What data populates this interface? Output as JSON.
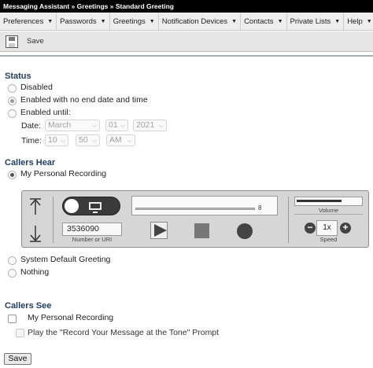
{
  "title_bar": "Messaging Assistant » Greetings » Standard Greeting",
  "menu": [
    {
      "label": "Preferences"
    },
    {
      "label": "Passwords"
    },
    {
      "label": "Greetings"
    },
    {
      "label": "Notification Devices"
    },
    {
      "label": "Contacts"
    },
    {
      "label": "Private Lists"
    },
    {
      "label": "Help"
    }
  ],
  "toolbar": {
    "save_label": "Save",
    "save_icon": "save-icon"
  },
  "status": {
    "heading": "Status",
    "options": [
      {
        "label": "Disabled",
        "selected": false
      },
      {
        "label": "Enabled with no end date and time",
        "selected": true
      },
      {
        "label": "Enabled until:",
        "selected": false
      }
    ],
    "date_label": "Date:",
    "date": {
      "month": "March",
      "day": "01",
      "year": "2021"
    },
    "time_label": "Time:",
    "time": {
      "hour": "10",
      "minute": "50",
      "ampm": "AM"
    }
  },
  "callers_hear": {
    "heading": "Callers Hear",
    "options": [
      {
        "label": "My Personal Recording",
        "selected": true
      },
      {
        "label": "System Default Greeting",
        "selected": false
      },
      {
        "label": "Nothing",
        "selected": false
      }
    ]
  },
  "player": {
    "number": "3536090",
    "number_caption": "Number or URI",
    "duration": "8",
    "volume_caption": "Volume",
    "volume_level": 0.7,
    "speed": "1x",
    "speed_caption": "Speed",
    "speed_minus": "−",
    "speed_plus": "+"
  },
  "callers_see": {
    "heading": "Callers See",
    "options": [
      {
        "label": "My Personal Recording",
        "checked": false,
        "disabled": false
      },
      {
        "label": "Play the \"Record Your Message at the Tone\" Prompt",
        "checked": false,
        "disabled": true
      }
    ]
  },
  "save_button": "Save"
}
